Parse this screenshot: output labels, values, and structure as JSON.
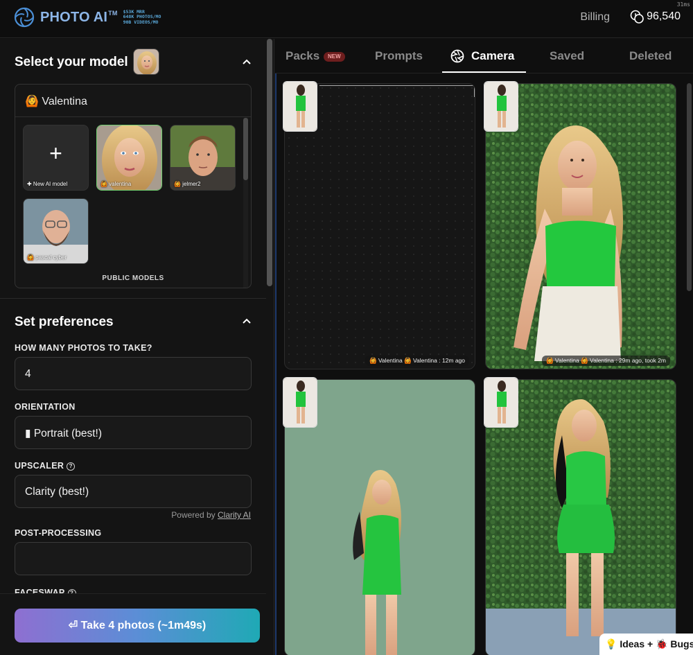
{
  "app": {
    "brand": "PHOTO AI",
    "brand_tm": "TM",
    "stats": [
      "$53K MRR",
      "648K PHOTOS/MO",
      "90B VIDEOS/MO"
    ],
    "billing_label": "Billing",
    "credits": "96,540",
    "perf_ms": "31ms"
  },
  "sidebar": {
    "model_section_title": "Select your model",
    "selected_model": "🙆 Valentina",
    "models": [
      {
        "label": "✚ New AI model"
      },
      {
        "label": "🙆 valentina"
      },
      {
        "label": "🙆 jelmer2"
      },
      {
        "label": "🙆 pascal cyber"
      }
    ],
    "public_models_label": "PUBLIC MODELS",
    "prefs_section_title": "Set preferences",
    "fields": {
      "photos_label": "HOW MANY PHOTOS TO TAKE?",
      "photos_value": "4",
      "orientation_label": "ORIENTATION",
      "orientation_value": "▮ Portrait (best!)",
      "upscaler_label": "UPSCALER",
      "upscaler_value": "Clarity (best!)",
      "powered_prefix": "Powered by",
      "powered_link": "Clarity AI",
      "postprocessing_label": "POST-PROCESSING",
      "postprocessing_value": "",
      "faceswap_label": "FACESWAP"
    },
    "cta_label": "⏎ Take 4 photos (~1m49s)"
  },
  "main": {
    "tabs": [
      {
        "label": "Packs",
        "badge": "NEW"
      },
      {
        "label": "Prompts"
      },
      {
        "label": "Camera",
        "active": true
      },
      {
        "label": "Saved"
      },
      {
        "label": "Deleted"
      }
    ],
    "cards": [
      {
        "meta": "🙆 Valentina 🙆 Valentina : 12m ago"
      },
      {
        "meta": "🙆 Valentina 🙆 Valentina : 29m ago, took 2m"
      },
      {
        "meta": ""
      },
      {
        "meta": ""
      }
    ]
  },
  "feedback_label": "💡 Ideas + 🐞 Bugs",
  "colors": {
    "accent_green": "#2fd04a",
    "cta_gradient_start": "#8e6fd1",
    "cta_gradient_end": "#1fa9b5",
    "badge_red": "#6e1e1e",
    "brand_blue": "#8db6e8"
  }
}
